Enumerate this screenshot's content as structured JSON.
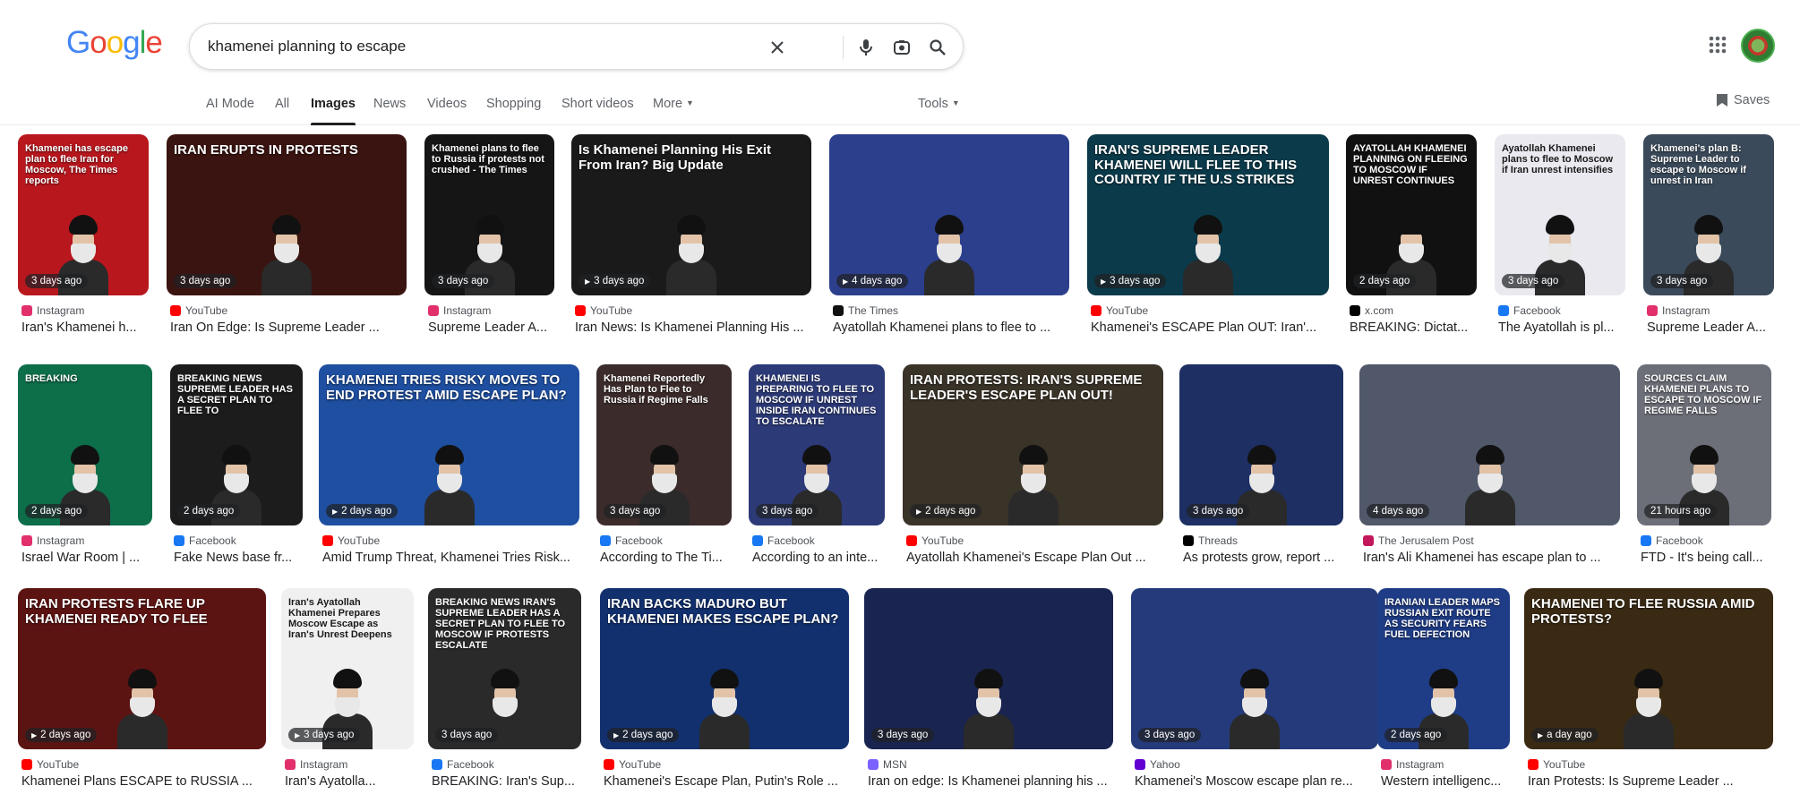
{
  "logo": {
    "letters": [
      "G",
      "o",
      "o",
      "g",
      "l",
      "e"
    ],
    "colors": [
      "#4285f4",
      "#ea4335",
      "#fbbc05",
      "#4285f4",
      "#34a853",
      "#ea4335"
    ]
  },
  "search": {
    "query": "khamenei planning to escape",
    "icons": [
      "close-icon",
      "mic-icon",
      "lens-icon",
      "search-icon"
    ]
  },
  "tabs": [
    {
      "label": "AI Mode",
      "active": false
    },
    {
      "label": "All",
      "active": false
    },
    {
      "label": "Images",
      "active": true
    },
    {
      "label": "News",
      "active": false
    },
    {
      "label": "Videos",
      "active": false
    },
    {
      "label": "Shopping",
      "active": false
    },
    {
      "label": "Short videos",
      "active": false
    },
    {
      "label": "More",
      "active": false
    }
  ],
  "tools": {
    "label": "Tools"
  },
  "saves": {
    "label": "Saves"
  },
  "results": [
    {
      "time": "3 days ago",
      "video": false,
      "source": "Instagram",
      "title": "Iran's Khamenei h...",
      "headline": "Khamenei has escape plan to flee Iran for Moscow, The Times reports",
      "bg": "#b8171e",
      "iconColor": "#e1306c"
    },
    {
      "time": "3 days ago",
      "video": false,
      "source": "YouTube",
      "title": "Iran On Edge: Is Supreme Leader ...",
      "headline": "IRAN ERUPTS IN PROTESTS",
      "bg": "#3a1410",
      "iconColor": "#ff0000"
    },
    {
      "time": "3 days ago",
      "video": false,
      "source": "Instagram",
      "title": "Supreme Leader A...",
      "headline": "Khamenei plans to flee to Russia if protests not crushed - The Times",
      "bg": "#151515",
      "iconColor": "#e1306c"
    },
    {
      "time": "3 days ago",
      "video": true,
      "source": "YouTube",
      "title": "Iran News: Is Khamenei Planning His ...",
      "headline": "Is Khamenei Planning His Exit From Iran? Big Update",
      "bg": "#1a1a1a",
      "iconColor": "#ff0000"
    },
    {
      "time": "4 days ago",
      "video": true,
      "source": "The Times",
      "title": "Ayatollah Khamenei plans to flee to ...",
      "headline": "",
      "bg": "#2b3f8c",
      "iconColor": "#111111"
    },
    {
      "time": "3 days ago",
      "video": true,
      "source": "YouTube",
      "title": "Khamenei's ESCAPE Plan OUT: Iran'...",
      "headline": "IRAN'S SUPREME LEADER KHAMENEI WILL FLEE TO THIS COUNTRY IF THE U.S STRIKES",
      "bg": "#0b3a4a",
      "iconColor": "#ff0000"
    },
    {
      "time": "2 days ago",
      "video": false,
      "source": "x.com",
      "title": "BREAKING: Dictat...",
      "headline": "AYATOLLAH KHAMENEI PLANNING ON FLEEING TO MOSCOW IF UNREST CONTINUES",
      "bg": "#111111",
      "iconColor": "#000000"
    },
    {
      "time": "3 days ago",
      "video": false,
      "source": "Facebook",
      "title": "The Ayatollah is pl...",
      "headline": "Ayatollah Khamenei plans to flee to Moscow if Iran unrest intensifies",
      "bg": "#e9e9ef",
      "iconColor": "#1877f2"
    },
    {
      "time": "3 days ago",
      "video": false,
      "source": "Instagram",
      "title": "Supreme Leader A...",
      "headline": "Khamenei's plan B: Supreme Leader to escape to Moscow if unrest in Iran",
      "bg": "#3a4a5a",
      "iconColor": "#e1306c"
    },
    {
      "time": "2 days ago",
      "video": false,
      "source": "Instagram",
      "title": "Israel War Room | ...",
      "headline": "BREAKING",
      "bg": "#0d6e4a",
      "iconColor": "#e1306c"
    },
    {
      "time": "2 days ago",
      "video": false,
      "source": "Facebook",
      "title": "Fake News base fr...",
      "headline": "BREAKING NEWS SUPREME LEADER HAS A SECRET PLAN TO FLEE TO",
      "bg": "#1c1c1c",
      "iconColor": "#1877f2"
    },
    {
      "time": "2 days ago",
      "video": true,
      "source": "YouTube",
      "title": "Amid Trump Threat, Khamenei Tries Risk...",
      "headline": "KHAMENEI TRIES RISKY MOVES TO END PROTEST AMID ESCAPE PLAN?",
      "bg": "#1f4fa0",
      "iconColor": "#ff0000"
    },
    {
      "time": "3 days ago",
      "video": false,
      "source": "Facebook",
      "title": "According to The Ti...",
      "headline": "Khamenei Reportedly Has Plan to Flee to Russia if Regime Falls",
      "bg": "#3b2b2a",
      "iconColor": "#1877f2"
    },
    {
      "time": "3 days ago",
      "video": false,
      "source": "Facebook",
      "title": "According to an inte...",
      "headline": "KHAMENEI IS PREPARING TO FLEE TO MOSCOW IF UNREST INSIDE IRAN CONTINUES TO ESCALATE",
      "bg": "#2c3a78",
      "iconColor": "#1877f2"
    },
    {
      "time": "2 days ago",
      "video": true,
      "source": "YouTube",
      "title": "Ayatollah Khamenei's Escape Plan Out ...",
      "headline": "IRAN PROTESTS: IRAN'S SUPREME LEADER'S ESCAPE PLAN OUT!",
      "bg": "#3a3328",
      "iconColor": "#ff0000"
    },
    {
      "time": "3 days ago",
      "video": false,
      "source": "Threads",
      "title": "As protests grow, report ...",
      "headline": "",
      "bg": "#1d2f63",
      "iconColor": "#000000"
    },
    {
      "time": "4 days ago",
      "video": false,
      "source": "The Jerusalem Post",
      "title": "Iran's Ali Khamenei has escape plan to ...",
      "headline": "",
      "bg": "#50586a",
      "iconColor": "#c2185b"
    },
    {
      "time": "21 hours ago",
      "video": false,
      "source": "Facebook",
      "title": "FTD - It's being call...",
      "headline": "SOURCES CLAIM KHAMENEI PLANS TO ESCAPE TO MOSCOW IF REGIME FALLS",
      "bg": "#6c6f78",
      "iconColor": "#1877f2"
    },
    {
      "time": "2 days ago",
      "video": true,
      "source": "YouTube",
      "title": "Khamenei Plans ESCAPE to RUSSIA ...",
      "headline": "IRAN PROTESTS FLARE UP KHAMENEI READY TO FLEE",
      "bg": "#5c1412",
      "iconColor": "#ff0000"
    },
    {
      "time": "3 days ago",
      "video": true,
      "source": "Instagram",
      "title": "Iran's Ayatolla...",
      "headline": "Iran's Ayatollah Khamenei Prepares Moscow Escape as Iran's Unrest Deepens",
      "bg": "#f0f0f0",
      "iconColor": "#e1306c"
    },
    {
      "time": "3 days ago",
      "video": false,
      "source": "Facebook",
      "title": "BREAKING: Iran's Sup...",
      "headline": "BREAKING NEWS IRAN'S SUPREME LEADER HAS A SECRET PLAN TO FLEE TO MOSCOW IF PROTESTS ESCALATE",
      "bg": "#2a2a2a",
      "iconColor": "#1877f2"
    },
    {
      "time": "2 days ago",
      "video": true,
      "source": "YouTube",
      "title": "Khamenei's Escape Plan, Putin's Role ...",
      "headline": "IRAN BACKS MADURO BUT KHAMENEI MAKES ESCAPE PLAN?",
      "bg": "#12306e",
      "iconColor": "#ff0000"
    },
    {
      "time": "3 days ago",
      "video": false,
      "source": "MSN",
      "title": "Iran on edge: Is Khamenei planning his ...",
      "headline": "",
      "bg": "#1a2450",
      "iconColor": "#7b61ff"
    },
    {
      "time": "3 days ago",
      "video": false,
      "source": "Yahoo",
      "title": "Khamenei's Moscow escape plan re...",
      "headline": "",
      "bg": "#243a7a",
      "iconColor": "#6001d2"
    },
    {
      "time": "2 days ago",
      "video": false,
      "source": "Instagram",
      "title": "Western intelligenc...",
      "headline": "IRANIAN LEADER MAPS RUSSIAN EXIT ROUTE AS SECURITY FEARS FUEL DEFECTION",
      "bg": "#1f3c86",
      "iconColor": "#e1306c"
    },
    {
      "time": "a day ago",
      "video": true,
      "source": "YouTube",
      "title": "Iran Protests: Is Supreme Leader ...",
      "headline": "KHAMENEI TO FLEE RUSSIA AMID PROTESTS?",
      "bg": "#3a2a14",
      "iconColor": "#ff0000"
    }
  ]
}
